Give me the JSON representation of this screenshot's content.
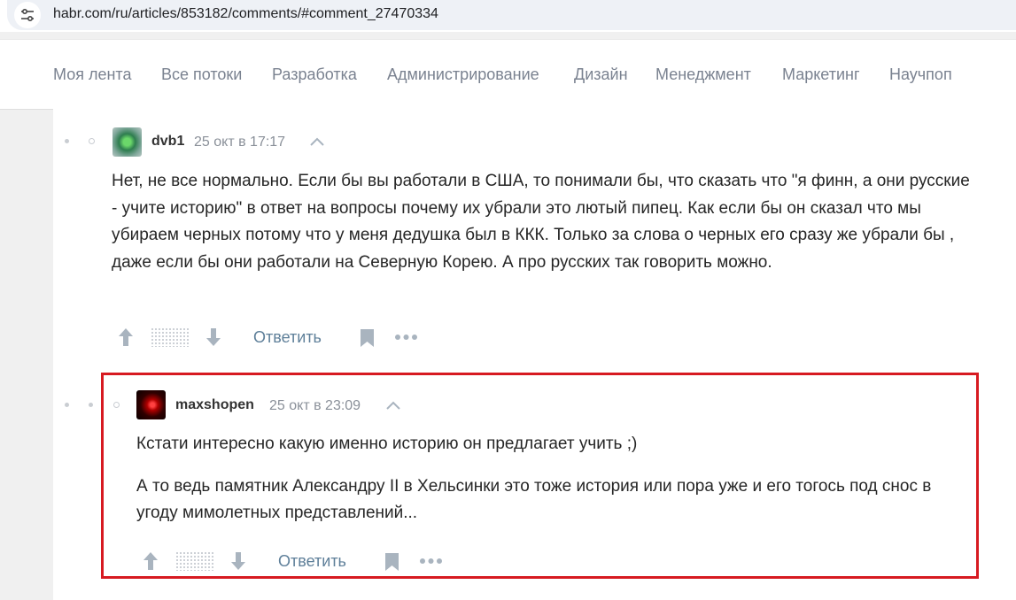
{
  "browser": {
    "url": "habr.com/ru/articles/853182/comments/#comment_27470334",
    "site_info_icon": "tune-icon"
  },
  "nav": {
    "items": [
      "Моя лента",
      "Все потоки",
      "Разработка",
      "Администрирование",
      "Дизайн",
      "Менеджмент",
      "Маркетинг",
      "Научпоп"
    ]
  },
  "comments": [
    {
      "username": "dvb1",
      "time": "25 окт в 17:17",
      "paragraphs": [
        "Нет, не все нормально. Если бы вы работали в США, то понимали бы, что сказать что \"я финн, а они русские - учите историю\" в ответ на вопросы почему их убрали это лютый пипец. Как если бы он сказал что мы убираем черных потому что у меня дедушка был в ККК. Только за слова о черных его сразу же убрали бы , даже если бы они работали на Северную Корею. А про русских так говорить можно."
      ],
      "reply_label": "Ответить"
    },
    {
      "username": "maxshopen",
      "time": "25 окт в 23:09",
      "paragraphs": [
        "Кстати интересно какую именно историю он предлагает учить ;)",
        "А то ведь памятник Александру II в Хельсинки это тоже история или пора уже и его тогось под снос в угоду мимолетных представлений..."
      ],
      "reply_label": "Ответить",
      "highlighted": true,
      "highlight_color": "#d71a21"
    }
  ],
  "colors": {
    "nav_text": "#7a8290",
    "reply_link": "#5e7f99",
    "icon_gray": "#a9b4bf"
  }
}
